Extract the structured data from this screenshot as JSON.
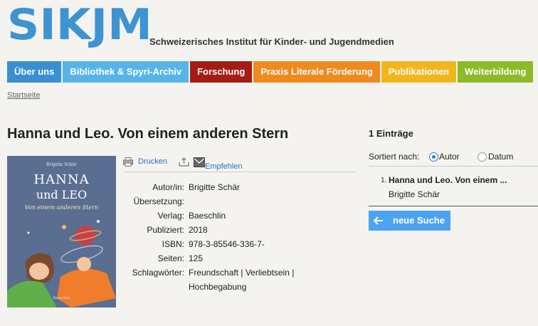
{
  "header": {
    "logo": "SIKJM",
    "site_name": "Schweizerisches Institut für Kinder- und Jugendmedien"
  },
  "nav": [
    {
      "label": "Über uns",
      "color": "#3a8fd2"
    },
    {
      "label": "Bibliothek & Spyri-Archiv",
      "color": "#56b4e9"
    },
    {
      "label": "Forschung",
      "color": "#a51c14"
    },
    {
      "label": "Praxis Literale Förderung",
      "color": "#ef8a1f"
    },
    {
      "label": "Publikationen",
      "color": "#f3b51d"
    },
    {
      "label": "Weiterbildung",
      "color": "#8cbb28"
    }
  ],
  "breadcrumb": "Startseite",
  "book": {
    "title": "Hanna und Leo. Von einem anderen Stern",
    "cover": {
      "author": "Brigitte Schär",
      "title_line1": "HANNA",
      "title_line2": "und LEO",
      "subtitle": "Von einem anderen Stern",
      "publisher": "Baeschlin"
    },
    "actions": {
      "print": "Drucken",
      "recommend": "Empfehlen"
    },
    "meta": [
      {
        "key": "Autor/in:",
        "value": "Brigitte Schär"
      },
      {
        "key": "Übersetzung:",
        "value": ""
      },
      {
        "key": "Verlag:",
        "value": "Baeschlin"
      },
      {
        "key": "Publiziert:",
        "value": "2018"
      },
      {
        "key": "ISBN:",
        "value": "978-3-85546-336-7-"
      },
      {
        "key": "Seiten:",
        "value": "125"
      },
      {
        "key": "Schlagwörter:",
        "value": "Freundschaft | Verliebtsein |"
      },
      {
        "key": "",
        "value": "Hochbegabung"
      }
    ]
  },
  "results": {
    "count": "1 Einträge",
    "sort_label": "Sortiert nach:",
    "sort_author": "Autor",
    "sort_date": "Datum",
    "items": [
      {
        "number": "1.",
        "title": "Hanna und Leo. Von einem ...",
        "author": "Brigitte Schär"
      }
    ],
    "new_search": "neue Suche"
  }
}
